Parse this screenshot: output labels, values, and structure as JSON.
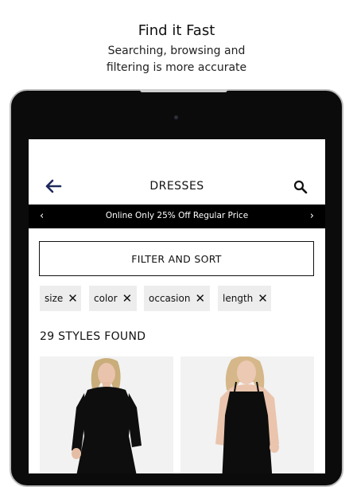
{
  "promo_header": {
    "headline": "Find it Fast",
    "sub_line1": "Searching, browsing and",
    "sub_line2": "filtering is more accurate"
  },
  "app": {
    "title": "DRESSES",
    "back_icon": "arrow-left-icon",
    "search_icon": "search-icon",
    "promo_banner": {
      "text": "Online Only 25% Off Regular Price",
      "prev_icon": "chevron-left-icon",
      "next_icon": "chevron-right-icon"
    },
    "filter_button": "FILTER AND SORT",
    "filter_chips": [
      {
        "label": "size"
      },
      {
        "label": "color"
      },
      {
        "label": "occasion"
      },
      {
        "label": "length"
      }
    ],
    "results_count": "29 STYLES FOUND",
    "products": [
      {
        "name": "black-long-sleeve-dress"
      },
      {
        "name": "black-slip-dress"
      }
    ]
  },
  "colors": {
    "accent": "#1f2a5c",
    "banner_bg": "#000000",
    "chip_bg": "#ededed"
  }
}
